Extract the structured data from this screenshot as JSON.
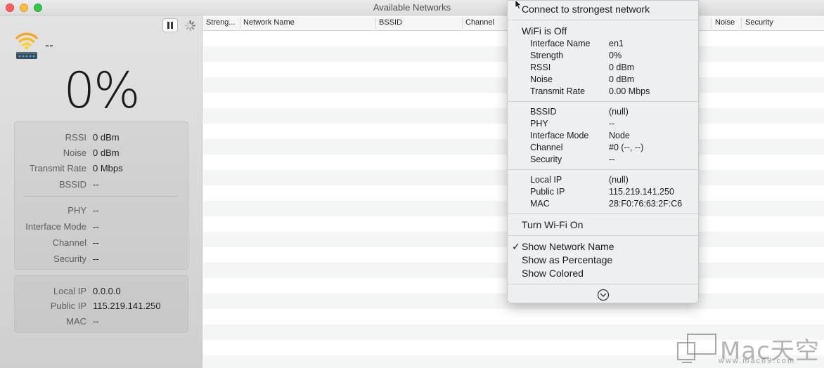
{
  "window": {
    "title": "Available Networks"
  },
  "sidebar": {
    "ssid": "--",
    "strength_pct": "0%",
    "signal_details": [
      {
        "label": "RSSI",
        "value": "0 dBm"
      },
      {
        "label": "Noise",
        "value": "0 dBm"
      },
      {
        "label": "Transmit Rate",
        "value": "0 Mbps"
      },
      {
        "label": "BSSID",
        "value": "--"
      }
    ],
    "link_details": [
      {
        "label": "PHY",
        "value": "--"
      },
      {
        "label": "Interface Mode",
        "value": "--"
      },
      {
        "label": "Channel",
        "value": "--"
      },
      {
        "label": "Security",
        "value": "--"
      }
    ],
    "address_details": [
      {
        "label": "Local IP",
        "value": "0.0.0.0"
      },
      {
        "label": "Public IP",
        "value": "115.219.141.250"
      },
      {
        "label": "MAC",
        "value": "--"
      }
    ]
  },
  "table": {
    "columns": [
      "Streng...",
      "Network Name",
      "BSSID",
      "Channel",
      "Noise",
      "Security"
    ]
  },
  "menu": {
    "connect_label": "Connect to strongest network",
    "status_label": "WiFi is Off",
    "group1": [
      {
        "label": "Interface Name",
        "value": "en1"
      },
      {
        "label": "Strength",
        "value": "0%"
      },
      {
        "label": "RSSI",
        "value": "0 dBm"
      },
      {
        "label": "Noise",
        "value": "0 dBm"
      },
      {
        "label": "Transmit Rate",
        "value": "0.00 Mbps"
      }
    ],
    "group2": [
      {
        "label": "BSSID",
        "value": "(null)"
      },
      {
        "label": "PHY",
        "value": "--"
      },
      {
        "label": "Interface Mode",
        "value": "Node"
      },
      {
        "label": "Channel",
        "value": "#0 (--, --)"
      },
      {
        "label": "Security",
        "value": "--"
      }
    ],
    "group3": [
      {
        "label": "Local IP",
        "value": "(null)"
      },
      {
        "label": "Public IP",
        "value": "115.219.141.250"
      },
      {
        "label": "MAC",
        "value": "28:F0:76:63:2F:C6"
      }
    ],
    "turn_on_label": "Turn Wi-Fi On",
    "options": [
      {
        "label": "Show Network Name",
        "checked": true
      },
      {
        "label": "Show as Percentage",
        "checked": false
      },
      {
        "label": "Show Colored",
        "checked": false
      }
    ]
  },
  "watermark": {
    "brand": "Mac天空",
    "url": "www.mac69.com"
  },
  "colors": {
    "wifi_orange": "#f5a623",
    "wifi_yellow": "#f8d32c",
    "stripe": "#f4f5f5"
  }
}
